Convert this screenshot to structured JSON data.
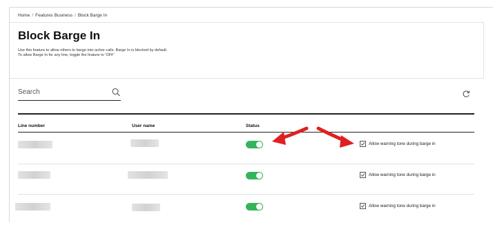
{
  "breadcrumb": {
    "items": [
      "Home",
      "Features Business",
      "Block Barge In"
    ],
    "separator": "/"
  },
  "header": {
    "title": "Block Barge In",
    "description_line1": "Use this feature to allow others to barge into active calls. Barge In is blocked by default.",
    "description_line2": "To allow Barge In for any line, toggle the feature to 'OFF'"
  },
  "search": {
    "placeholder": "Search",
    "icon": "search-icon"
  },
  "toolbar": {
    "refresh_icon": "refresh-icon"
  },
  "table": {
    "columns": [
      "Line number",
      "User name",
      "Status",
      ""
    ],
    "rows": [
      {
        "line_number": "",
        "user_name": "",
        "status_on": true,
        "warning_tone_checked": true,
        "warning_tone_label": "Allow warning tone during barge in"
      },
      {
        "line_number": "",
        "user_name": "",
        "status_on": true,
        "warning_tone_checked": true,
        "warning_tone_label": "Allow warning tone during barge in"
      },
      {
        "line_number": "",
        "user_name": "",
        "status_on": true,
        "warning_tone_checked": true,
        "warning_tone_label": "Allow warning tone during barge in"
      }
    ]
  },
  "colors": {
    "toggle_on": "#35b45c",
    "annotation_arrow": "#e02020"
  }
}
